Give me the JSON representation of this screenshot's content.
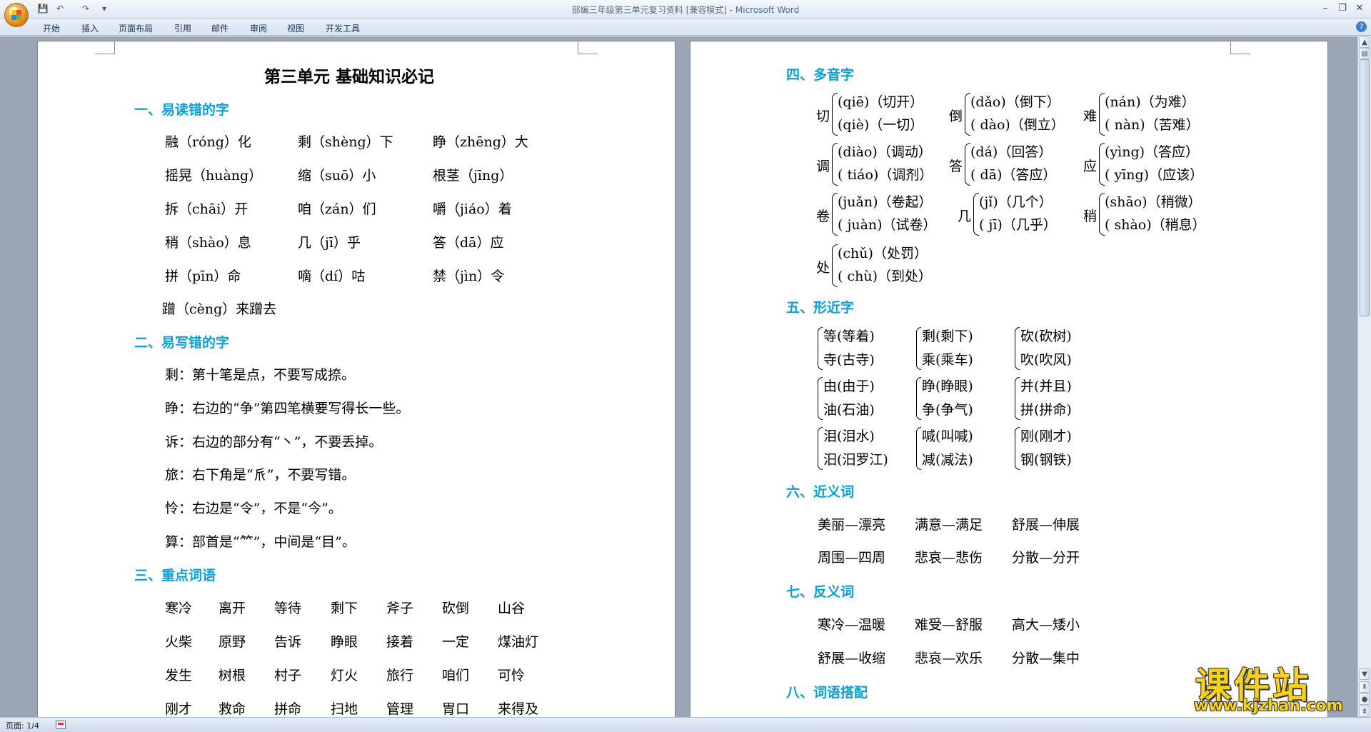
{
  "window": {
    "title": "部编三年级第三单元复习资料 [兼容模式] - ",
    "app_name": "Microsoft Word"
  },
  "ribbon": {
    "tabs": [
      "开始",
      "插入",
      "页面布局",
      "引用",
      "邮件",
      "审阅",
      "视图",
      "开发工具"
    ]
  },
  "doc": {
    "title": "第三单元 基础知识必记",
    "s1": {
      "heading": "一、易读错的字",
      "rows": [
        [
          "融（róng）化",
          "剩（shèng）下",
          "睁（zhēng）大"
        ],
        [
          "摇晃（huàng）",
          "缩（suō）小",
          "根茎（jīng）"
        ],
        [
          "拆（chāi）开",
          "咱（zán）们",
          "嚼（jiáo）着"
        ],
        [
          "稍（shào）息",
          "几（jī）乎",
          "答（dā）应"
        ],
        [
          "拼（pīn）命",
          "嘀（dí）咕",
          "禁（jìn）令"
        ]
      ],
      "last": "蹭（cèng）来蹭去"
    },
    "s2": {
      "heading": "二、易写错的字",
      "lines": [
        "剩：第十笔是点，不要写成捺。",
        "睁：右边的“争”第四笔横要写得长一些。",
        "诉：右边的部分有“丶”，不要丢掉。",
        "旅：右下角是“𠂢”，不要写错。",
        "怜：右边是“令”，不是“今”。",
        "算：部首是“⺮”，中间是“目”。"
      ]
    },
    "s3": {
      "heading": "三、重点词语",
      "rows": [
        [
          "寒冷",
          "离开",
          "等待",
          "剩下",
          "斧子",
          "砍倒",
          "山谷"
        ],
        [
          "火柴",
          "原野",
          "告诉",
          "睁眼",
          "接着",
          "一定",
          "煤油灯"
        ],
        [
          "发生",
          "树根",
          "村子",
          "灯火",
          "旅行",
          "咱们",
          "可怜"
        ],
        [
          "刚才",
          "救命",
          "拼命",
          "扫地",
          "管理",
          "胃口",
          "来得及"
        ]
      ]
    },
    "s4": {
      "heading": "四、多音字",
      "items": [
        {
          "ch": "切",
          "r1": "(qiē)（切开）",
          "r2": "(qiè)（一切）"
        },
        {
          "ch": "倒",
          "r1": "(dǎo)（倒下）",
          "r2": "( dào)（倒立）"
        },
        {
          "ch": "难",
          "r1": "(nán)（为难）",
          "r2": "( nàn)（苦难）"
        },
        {
          "ch": "调",
          "r1": "(diào)（调动）",
          "r2": "( tiáo)（调剂）"
        },
        {
          "ch": "答",
          "r1": "(dá)（回答）",
          "r2": "( dā)（答应）"
        },
        {
          "ch": "应",
          "r1": "(yìng)（答应）",
          "r2": "( yīng)（应该）"
        },
        {
          "ch": "卷",
          "r1": "(juǎn)（卷起）",
          "r2": "( juàn)（试卷）"
        },
        {
          "ch": "几",
          "r1": "(jǐ)（几个）",
          "r2": "( jī)（几乎）"
        },
        {
          "ch": "稍",
          "r1": "(shāo)（稍微）",
          "r2": "( shào)（稍息）"
        },
        {
          "ch": "处",
          "r1": "(chǔ)（处罚）",
          "r2": "( chù)（到处）"
        }
      ]
    },
    "s5": {
      "heading": "五、形近字",
      "items": [
        {
          "r1": "等(等着)",
          "r2": "寺(古寺)"
        },
        {
          "r1": "剩(剩下)",
          "r2": "乘(乘车)"
        },
        {
          "r1": "砍(砍树)",
          "r2": "吹(吹风)"
        },
        {
          "r1": "由(由于)",
          "r2": "油(石油)"
        },
        {
          "r1": "睁(睁眼)",
          "r2": "争(争气)"
        },
        {
          "r1": "并(并且)",
          "r2": "拼(拼命)"
        },
        {
          "r1": "泪(泪水)",
          "r2": "汨(汨罗江)"
        },
        {
          "r1": "喊(叫喊)",
          "r2": "减(减法)"
        },
        {
          "r1": "刚(刚才)",
          "r2": "钢(钢铁)"
        }
      ]
    },
    "s6": {
      "heading": "六、近义词",
      "rows": [
        [
          "美丽—漂亮",
          "满意—满足",
          "舒展—伸展"
        ],
        [
          "周围—四周",
          "悲哀—悲伤",
          "分散—分开"
        ]
      ]
    },
    "s7": {
      "heading": "七、反义词",
      "rows": [
        [
          "寒冷—温暖",
          "难受—舒服",
          "高大—矮小"
        ],
        [
          "舒展—收缩",
          "悲哀—欢乐",
          "分散—集中"
        ]
      ]
    },
    "s8": {
      "heading": "八、词语搭配"
    }
  },
  "status": {
    "page": "页面: 1/4"
  },
  "watermark": {
    "cn": "课件站",
    "url": "www.kjzhan.com"
  },
  "colors": {
    "heading": "#0a9fd8",
    "watermark": "#f6d21f"
  }
}
